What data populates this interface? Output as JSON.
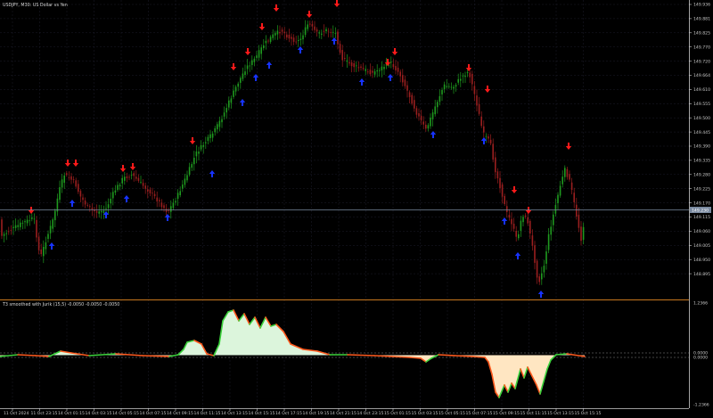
{
  "header": {
    "symbol_line": "USDJPY, M30:  US Dollar vs Yen"
  },
  "indicator": {
    "label": "T3 smoothed with Jurik (15,5) -0.0050 -0.0050 -0.0050"
  },
  "price_scale": {
    "ticks": [
      "149.936",
      "149.881",
      "149.825",
      "149.770",
      "149.720",
      "149.664",
      "149.610",
      "149.555",
      "149.500",
      "149.445",
      "149.390",
      "149.335",
      "149.280",
      "149.225",
      "149.170",
      "149.115",
      "149.060",
      "149.005",
      "148.950",
      "148.895"
    ],
    "current_price": "149.230"
  },
  "indicator_scale": {
    "ticks": [
      "1.2366",
      "0.0000",
      "0.0000",
      "-1.2366"
    ]
  },
  "time_axis": {
    "ticks": [
      "11 Oct 2024",
      "11 Oct 23:15",
      "14 Oct 01:15",
      "14 Oct 03:15",
      "14 Oct 05:15",
      "14 Oct 07:15",
      "14 Oct 09:15",
      "14 Oct 11:15",
      "14 Oct 13:15",
      "14 Oct 15:15",
      "14 Oct 17:15",
      "14 Oct 19:15",
      "14 Oct 21:15",
      "14 Oct 23:15",
      "15 Oct 01:15",
      "15 Oct 03:15",
      "15 Oct 05:15",
      "15 Oct 07:15",
      "15 Oct 09:15",
      "15 Oct 11:15",
      "15 Oct 13:15",
      "15 Oct 15:15"
    ]
  },
  "colors": {
    "background": "#000000",
    "grid": "#1c1c2a",
    "bull": "#1f9a1f",
    "bear": "#9a1f1f",
    "up_arrow": "#1733ff",
    "down_arrow": "#ff1a1a",
    "separator": "#c8781e",
    "current_line": "#7a8aa0",
    "osc_line_up": "#3cd23c",
    "osc_line_down": "#ff5a1e",
    "osc_fill_up": "#dcf5dc",
    "osc_fill_down": "#ffe6c2"
  }
}
